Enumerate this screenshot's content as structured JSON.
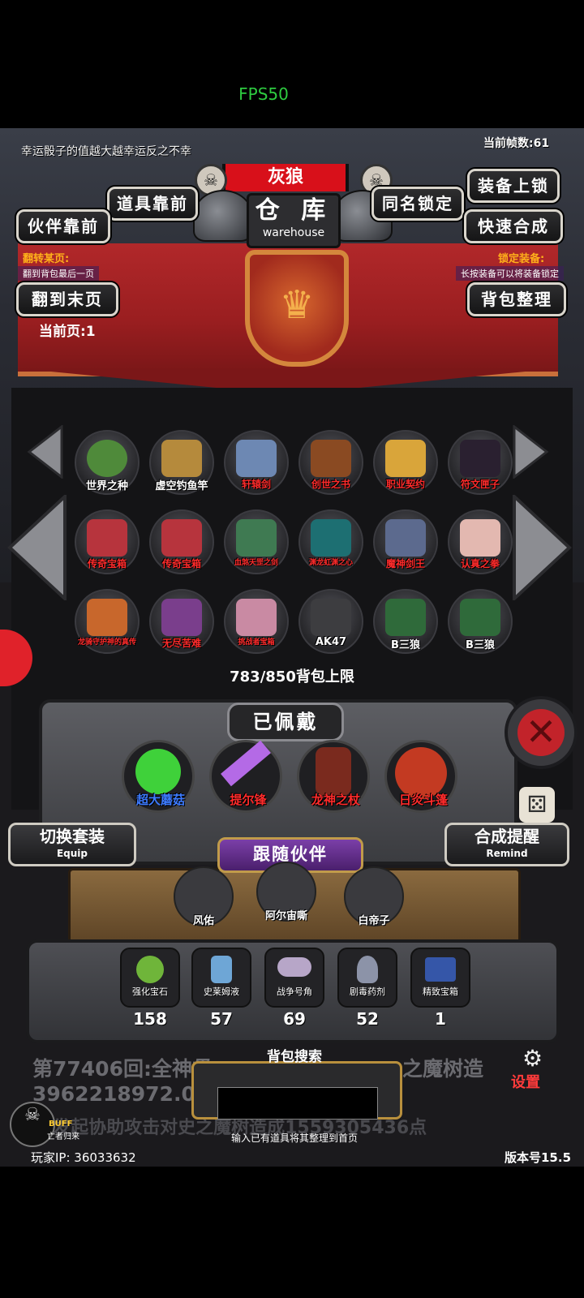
{
  "status": {
    "fps": "FPS50"
  },
  "header": {
    "luck_text": "幸运骰子的值越大越幸运反之不幸",
    "frame_count": "当前帧数:61",
    "player_name": "灰狼",
    "warehouse_title": "仓 库",
    "warehouse_subtitle": "warehouse"
  },
  "buttons": {
    "items_front": "道具靠前",
    "partner_front": "伙伴靠前",
    "same_name_lock": "同名锁定",
    "equip_lock": "装备上锁",
    "quick_merge": "快速合成",
    "goto_last_page": "翻到末页",
    "sort_bag": "背包整理"
  },
  "banner": {
    "flip_label": "翻转某页:",
    "flip_hint": "翻到背包最后一页",
    "lock_label": "锁定装备:",
    "lock_hint": "长按装备可以将装备锁定",
    "current_page": "当前页:1"
  },
  "bag": {
    "items": [
      {
        "name": "世界之种",
        "red": false
      },
      {
        "name": "虚空钓鱼竿",
        "red": false
      },
      {
        "name": "轩辕剑",
        "red": true
      },
      {
        "name": "创世之书",
        "red": true
      },
      {
        "name": "职业契约",
        "red": true
      },
      {
        "name": "符文匣子",
        "red": true
      },
      {
        "name": "传奇宝箱",
        "red": true
      },
      {
        "name": "传奇宝箱",
        "red": true
      },
      {
        "name": "血煞天罡之剑",
        "red": true
      },
      {
        "name": "渊龙虹渊之心",
        "red": true
      },
      {
        "name": "魔神剑王",
        "red": true
      },
      {
        "name": "认真之拳",
        "red": true
      },
      {
        "name": "龙骑守护神的真传",
        "red": true
      },
      {
        "name": "无尽苦难",
        "red": true
      },
      {
        "name": "挑战者宝箱",
        "red": true
      },
      {
        "name": "AK47",
        "red": false
      },
      {
        "name": "B三狼",
        "red": false
      },
      {
        "name": "B三狼",
        "red": false
      }
    ],
    "capacity": "783/850背包上限"
  },
  "equipped": {
    "title": "已佩戴",
    "items": [
      {
        "name": "超大蘑菇",
        "color": "#3d7bff"
      },
      {
        "name": "提尔锋",
        "color": "#ff2b2b"
      },
      {
        "name": "龙神之杖",
        "color": "#ff2b2b"
      },
      {
        "name": "日炎斗篷",
        "color": "#ff2b2b"
      }
    ]
  },
  "switch_set": {
    "label": "切换套装",
    "sub": "Equip"
  },
  "merge_remind": {
    "label": "合成提醒",
    "sub": "Remind"
  },
  "partners": {
    "title": "跟随伙伴",
    "items": [
      "风佑",
      "阿尔宙嘶",
      "白帝子"
    ]
  },
  "materials": [
    {
      "name": "强化宝石",
      "count": "158"
    },
    {
      "name": "史莱姆液",
      "count": "57"
    },
    {
      "name": "战争号角",
      "count": "69"
    },
    {
      "name": "剧毒药剂",
      "count": "52"
    },
    {
      "name": "精致宝箱",
      "count": "1"
    }
  ],
  "ticker": {
    "line1": "第77406回:全神贯",
    "line1b": "之魔树造",
    "line2": "3962218972.00",
    "line3": "...发起协助攻击对史之魔树造成1559305436点"
  },
  "search": {
    "title": "背包搜索",
    "value": "",
    "hint": "输入已有道具将其整理到首页"
  },
  "footer": {
    "ip": "玩家IP: 36033632",
    "version": "版本号15.5",
    "settings": "设置",
    "buff": "BUFF",
    "buff_sub": "亡者归来"
  },
  "colors": {
    "red": "#d8101a",
    "accent_gold": "#c19b4a",
    "purple": "#7b3fa8"
  }
}
